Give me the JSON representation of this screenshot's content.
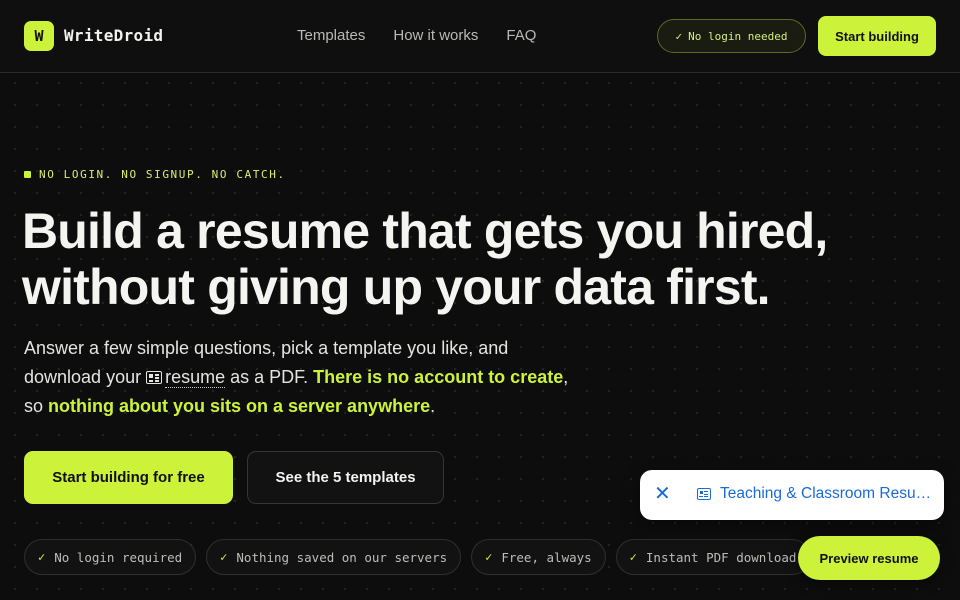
{
  "nav": {
    "logo_mark": "W",
    "logo_text": "WriteDroid",
    "links": [
      "Templates",
      "How it works",
      "FAQ"
    ],
    "pill_check": "✓",
    "pill_label": "No login needed",
    "cta_label": "Start building"
  },
  "hero": {
    "eyebrow": "NO LOGIN. NO SIGNUP. NO CATCH.",
    "headline_line1": "Build a resume that gets you hired,",
    "headline_line2": "without giving up your data first.",
    "sub_part1": "Answer a few simple questions, pick a template you like, and download your ",
    "sub_doc_word": "resume",
    "sub_part2": " as a PDF. ",
    "sub_highlight1": "There is no account to create",
    "sub_part3": ", so ",
    "sub_highlight2": "nothing about you sits on a server anywhere",
    "sub_part4": ".",
    "primary_button": "Start building for free",
    "secondary_button": "See the 5 templates"
  },
  "features": [
    {
      "check": "✓",
      "label": "No login required"
    },
    {
      "check": "✓",
      "label": "Nothing saved on our servers"
    },
    {
      "check": "✓",
      "label": "Free, always"
    },
    {
      "check": "✓",
      "label": "Instant PDF download"
    }
  ],
  "toast": {
    "close_glyph": "✕",
    "text": "Teaching & Classroom Resume"
  },
  "preview_button": "Preview resume",
  "colors": {
    "accent": "#cdf23a",
    "background": "#0d0d0e",
    "link_blue": "#1a6ad8"
  }
}
